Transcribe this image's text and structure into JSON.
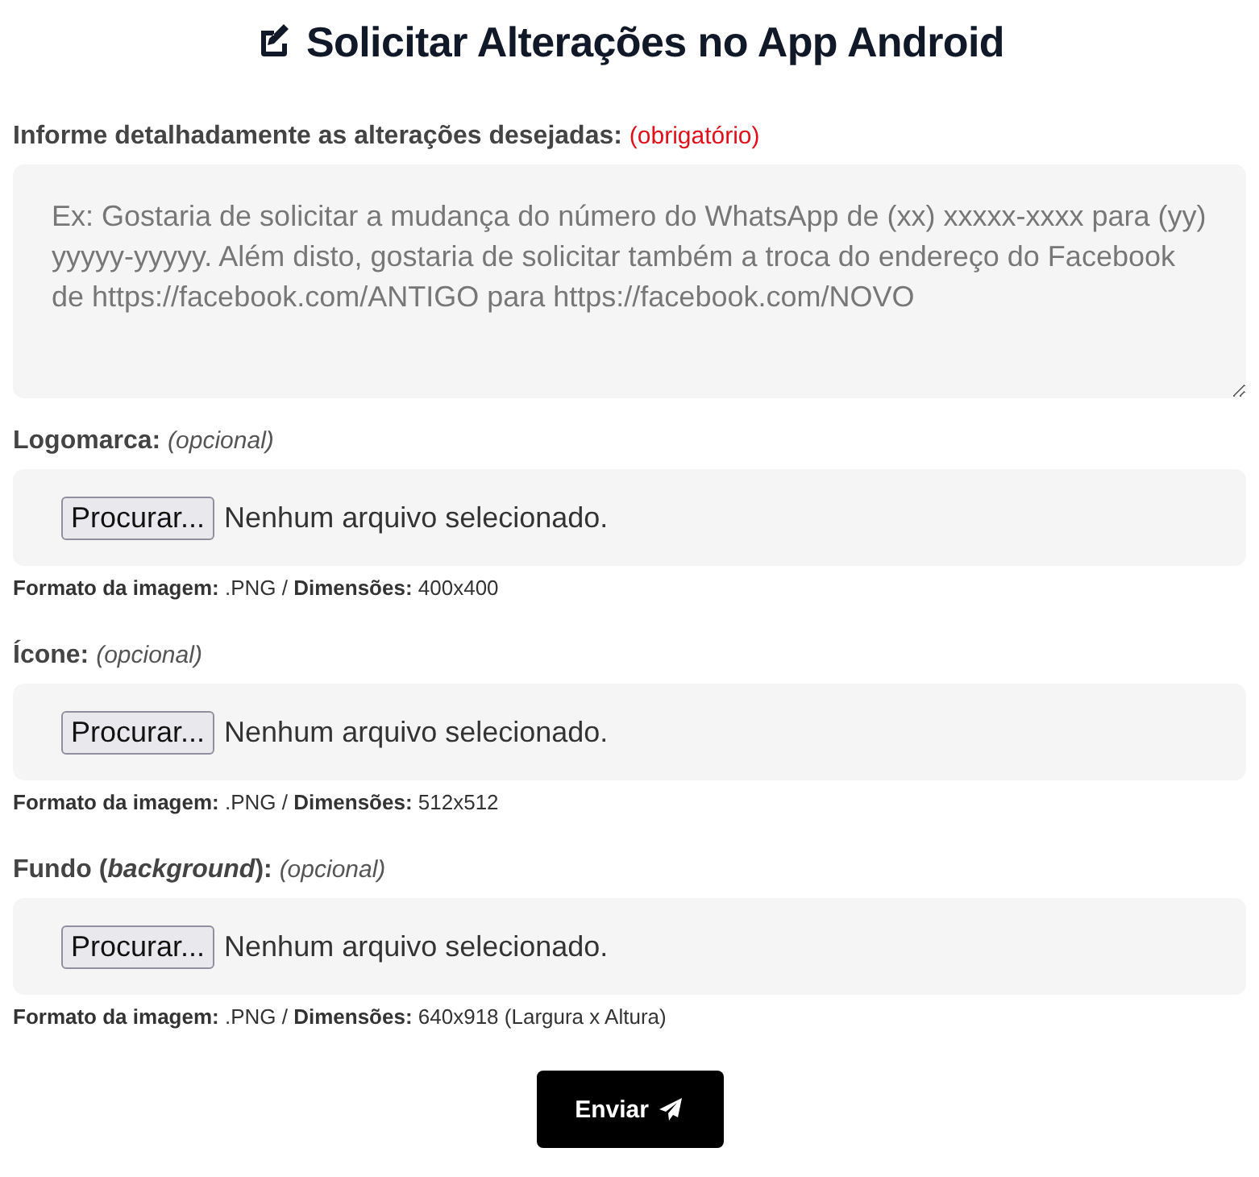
{
  "title": "Solicitar Alterações no App Android",
  "details": {
    "label": "Informe detalhadamente as alterações desejadas:",
    "requirement": "(obrigatório)",
    "placeholder": "Ex: Gostaria de solicitar a mudança do número do WhatsApp de (xx) xxxxx-xxxx para (yy) yyyyy-yyyyy. Além disto, gostaria de solicitar também a troca do endereço do Facebook de https://facebook.com/ANTIGO para https://facebook.com/NOVO"
  },
  "uploads": [
    {
      "label": "Logomarca:",
      "requirement": "(opcional)",
      "browse_button": "Procurar...",
      "status": "Nenhum arquivo selecionado.",
      "hint": "**Formato da imagem:** .PNG / **Dimensões:** 400x400"
    },
    {
      "label": "Ícone:",
      "requirement": "(opcional)",
      "browse_button": "Procurar...",
      "status": "Nenhum arquivo selecionado.",
      "hint": "**Formato da imagem:** .PNG / **Dimensões:** 512x512"
    },
    {
      "label": "Fundo (*background*):",
      "requirement": "(opcional)",
      "browse_button": "Procurar...",
      "status": "Nenhum arquivo selecionado.",
      "hint": "**Formato da imagem:** .PNG / **Dimensões:** 640x918 (Largura x Altura)"
    }
  ],
  "submit_button": "Enviar"
}
